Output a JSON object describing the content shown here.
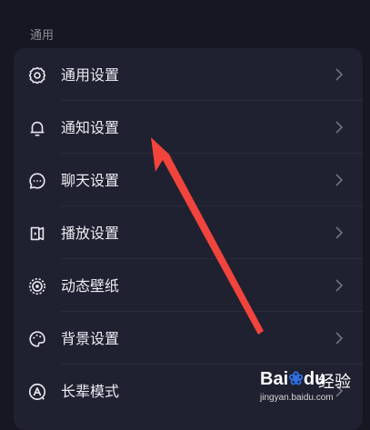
{
  "section": {
    "title": "通用"
  },
  "settings": {
    "items": [
      {
        "label": "通用设置",
        "icon": "gear-icon"
      },
      {
        "label": "通知设置",
        "icon": "bell-icon"
      },
      {
        "label": "聊天设置",
        "icon": "chat-bubble-icon"
      },
      {
        "label": "播放设置",
        "icon": "playback-icon"
      },
      {
        "label": "动态壁纸",
        "icon": "live-wallpaper-icon"
      },
      {
        "label": "背景设置",
        "icon": "palette-icon"
      },
      {
        "label": "长辈模式",
        "icon": "elder-mode-icon"
      }
    ]
  },
  "watermark": {
    "logo_text": "Bai",
    "logo_text2": "du",
    "brand": "经验",
    "url": "jingyan.baidu.com"
  },
  "colors": {
    "background": "#161722",
    "card": "#1f2030",
    "text": "#ececf2",
    "muted": "#8a8b95",
    "annotation_arrow": "#f0443c"
  }
}
